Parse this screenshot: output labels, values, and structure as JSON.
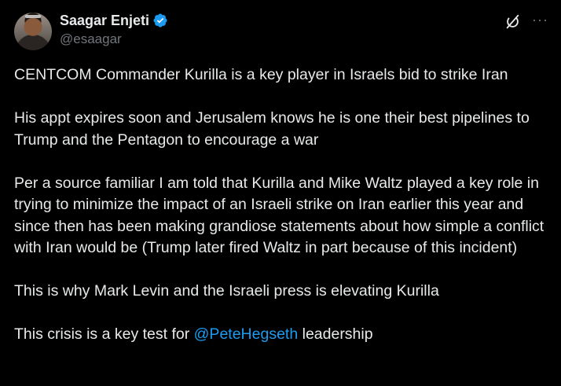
{
  "author": {
    "display_name": "Saagar Enjeti",
    "handle": "@esaagar",
    "verified": true
  },
  "icons": {
    "verified_badge": "verified-badge-icon",
    "grok": "grok-icon",
    "more": "more-icon"
  },
  "colors": {
    "background": "#000000",
    "text": "#e7e9ea",
    "secondary_text": "#71767b",
    "link": "#1d9bf0",
    "verified": "#1d9bf0"
  },
  "tweet": {
    "paragraphs": [
      "CENTCOM Commander Kurilla is a key player in Israels bid to strike Iran",
      "His appt expires soon and Jerusalem knows he is one their best pipelines to Trump and the Pentagon to encourage a war",
      "Per a source familiar I am told that Kurilla and Mike Waltz played a key role in trying to minimize the impact of an Israeli strike on Iran earlier this year and since then has been making grandiose statements about how simple a conflict with Iran would be (Trump later fired Waltz in part because of this incident)",
      "This is why Mark Levin and the Israeli press is elevating Kurilla"
    ],
    "last_paragraph": {
      "before": "This crisis is a key test for ",
      "mention": "@PeteHegseth",
      "after": " leadership"
    }
  }
}
